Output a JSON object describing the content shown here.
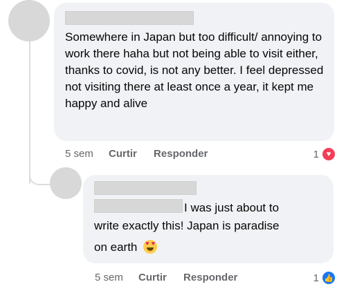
{
  "comments": [
    {
      "text": "Somewhere in Japan but too difficult/ annoying to work there haha but not being able to visit either, thanks to covid, is not any better. I feel depressed not visiting there at least once a year, it kept me happy and alive",
      "time": "5 sem",
      "like_label": "Curtir",
      "reply_label": "Responder",
      "reaction_count": "1",
      "reaction_icon": "heart-icon",
      "reaction_color": "#f33e58"
    },
    {
      "text_line1": "I was just about to",
      "text_line2": "write exactly this! Japan is paradise",
      "text_line3": "on earth",
      "emoji": "heart-eyes-emoji",
      "time": "5 sem",
      "like_label": "Curtir",
      "reply_label": "Responder",
      "reaction_count": "1",
      "reaction_icon": "thumbs-up-icon",
      "reaction_color": "#1877f2"
    }
  ],
  "colors": {
    "bubble": "#f0f2f5",
    "meta_text": "#65676b",
    "body_text": "#050505"
  }
}
